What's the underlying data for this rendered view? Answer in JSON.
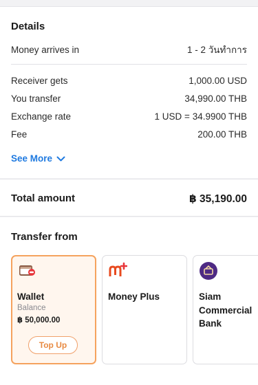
{
  "details": {
    "title": "Details",
    "arrival_label": "Money arrives in",
    "arrival_value": "1 - 2 วันทำการ",
    "rows": [
      {
        "label": "Receiver gets",
        "value": "1,000.00 USD"
      },
      {
        "label": "You transfer",
        "value": "34,990.00 THB"
      },
      {
        "label": "Exchange rate",
        "value": "1 USD = 34.9900 THB"
      },
      {
        "label": "Fee",
        "value": "200.00 THB"
      }
    ],
    "see_more": "See More"
  },
  "total": {
    "label": "Total amount",
    "value": "฿ 35,190.00"
  },
  "transfer_from": {
    "title": "Transfer from",
    "sources": [
      {
        "name": "Wallet",
        "balance_label": "Balance",
        "balance_value": "฿ 50,000.00",
        "action": "Top Up",
        "selected": true,
        "icon": "wallet-icon"
      },
      {
        "name": "Money Plus",
        "selected": false,
        "icon": "money-plus-icon"
      },
      {
        "name": "Siam Commercial Bank",
        "selected": false,
        "icon": "scb-bank-icon"
      }
    ]
  },
  "colors": {
    "accent_blue": "#1f7ae0",
    "selected_orange": "#f5a25d",
    "selected_bg": "#fff6ee"
  }
}
